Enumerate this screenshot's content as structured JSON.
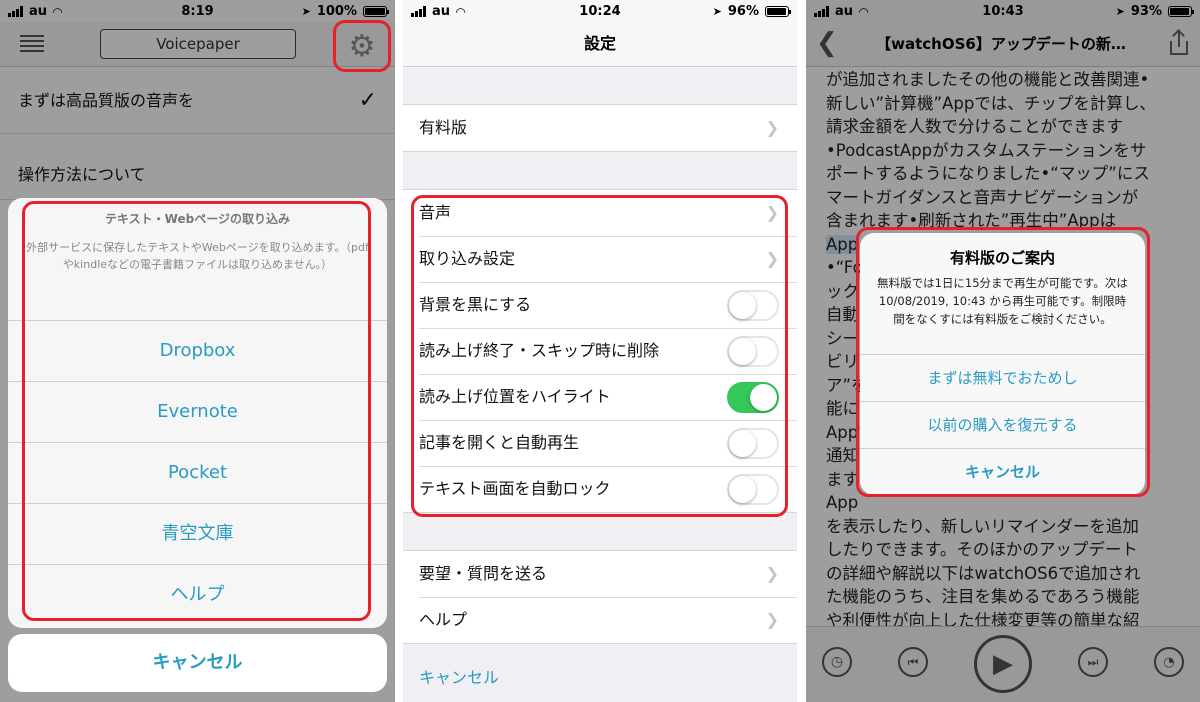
{
  "colors": {
    "accent": "#2a9bc3",
    "highlight_frame": "#e6212b",
    "toggle_on": "#34c759"
  },
  "panel1": {
    "status": {
      "carrier": "au",
      "time": "8:19",
      "battery": "100%"
    },
    "nav": {
      "title": "Voicepaper",
      "menu_icon": "list-icon",
      "settings_icon": "gear-icon"
    },
    "rows": [
      {
        "label": "まずは高品質版の音声を",
        "checked": true
      },
      {
        "label": "操作方法について"
      }
    ],
    "sheet": {
      "title": "テキスト・Webページの取り込み",
      "message": "外部サービスに保存したテキストやWebページを取り込めます。（pdfやkindleなどの電子書籍ファイルは取り込めません。）",
      "options": [
        "Dropbox",
        "Evernote",
        "Pocket",
        "青空文庫",
        "ヘルプ"
      ],
      "cancel": "キャンセル"
    }
  },
  "panel2": {
    "status": {
      "carrier": "au",
      "time": "10:24",
      "battery": "96%"
    },
    "nav": {
      "title": "設定"
    },
    "group1": [
      {
        "label": "有料版"
      }
    ],
    "group2": [
      {
        "label": "音声",
        "type": "chevron"
      },
      {
        "label": "取り込み設定",
        "type": "chevron"
      },
      {
        "label": "背景を黒にする",
        "type": "toggle",
        "on": false
      },
      {
        "label": "読み上げ終了・スキップ時に削除",
        "type": "toggle",
        "on": false
      },
      {
        "label": "読み上げ位置をハイライト",
        "type": "toggle",
        "on": true
      },
      {
        "label": "記事を開くと自動再生",
        "type": "toggle",
        "on": false
      },
      {
        "label": "テキスト画面を自動ロック",
        "type": "toggle",
        "on": false
      }
    ],
    "group3": [
      {
        "label": "要望・質問を送る"
      },
      {
        "label": "ヘルプ"
      }
    ],
    "cancel": "キャンセル"
  },
  "panel3": {
    "status": {
      "carrier": "au",
      "time": "10:43",
      "battery": "93%"
    },
    "nav": {
      "title": "【watchOS6】アップデートの新…"
    },
    "article_lines": [
      "が追加されましたその他の機能と改善関連•",
      "新しい”計算機”Appでは、チップを計算し、",
      "請求金額を人数で分けることができます",
      "•PodcastAppがカスタムステーションをサ",
      "ポートするようになりました•“マップ”にス",
      "マートガイダンスと音声ナビゲーションが",
      "含まれます•刷新された”再生中”Appは",
      "App",
      "•“Fo",
      "ック",
      "自動",
      "シー",
      "ビリ",
      "ア”を",
      "能に",
      "Appで",
      "通知",
      "ます",
      "App",
      "を表示したり、新しいリマインダーを追加",
      "したりできます。そのほかのアップデート",
      "の詳細や解説以下はwatchOS6で追加され",
      "た機能のうち、注目を集めるであろう機能",
      "や利便性が向上した仕様変更等の簡単な紹"
    ],
    "alert": {
      "title": "有料版のご案内",
      "message": "無料版では1日に15分まで再生が可能です。次は 10/08/2019, 10:43 から再生可能です。制限時間をなくすには有料版をご検討ください。",
      "buttons": [
        "まずは無料でおためし",
        "以前の購入を復元する",
        "キャンセル"
      ]
    }
  }
}
